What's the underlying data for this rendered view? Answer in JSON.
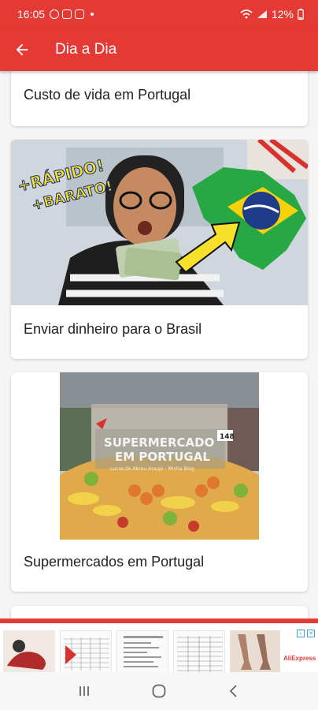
{
  "status": {
    "time": "16:05",
    "battery": "12%"
  },
  "appbar": {
    "title": "Dia a Dia"
  },
  "cards": [
    {
      "label": "Custo de vida em Portugal"
    },
    {
      "label": "Enviar dinheiro para o Brasil",
      "thumb_text_1": "+RÁPIDO!",
      "thumb_text_2": "+BARATO!"
    },
    {
      "label": "Supermercados em Portugal",
      "thumb_title_1": "SUPERMERCADO",
      "thumb_title_2": "EM PORTUGAL",
      "thumb_caption": "Lucas de Abreu Araujo - Minha Blog",
      "thumb_sign": "148"
    }
  ],
  "ad": {
    "brand": "AliExpress"
  },
  "colors": {
    "primary": "#e53935",
    "background": "#f5f5f5"
  }
}
